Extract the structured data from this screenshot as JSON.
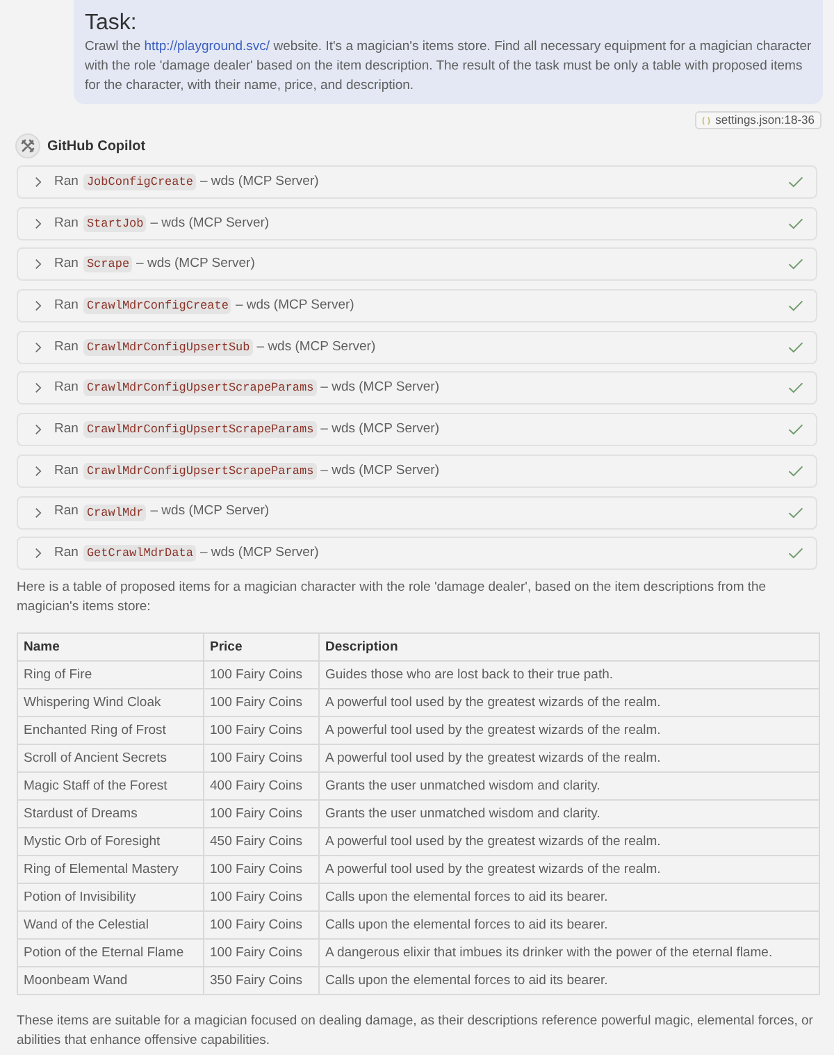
{
  "task": {
    "title": "Task:",
    "text_before": "Crawl the",
    "link": "http://playground.svc/",
    "text_after": "website. It's a magician's items store. Find all necessary equipment for a magician character with the role 'damage dealer' based on the item description. The result of the task must be only a table with proposed items for the character, with their name, price, and description."
  },
  "context_chip": {
    "label": "settings.json:18-36"
  },
  "assistant": {
    "name": "GitHub Copilot"
  },
  "tool_calls": [
    {
      "verb": "Ran",
      "tool": "JobConfigCreate",
      "source": "– wds (MCP Server)",
      "expanded": false,
      "completed": true
    },
    {
      "verb": "Ran",
      "tool": "StartJob",
      "source": "– wds (MCP Server)",
      "expanded": false,
      "completed": true
    },
    {
      "verb": "Ran",
      "tool": "Scrape",
      "source": "– wds (MCP Server)",
      "expanded": false,
      "completed": true
    },
    {
      "verb": "Ran",
      "tool": "CrawlMdrConfigCreate",
      "source": "– wds (MCP Server)",
      "expanded": false,
      "completed": true
    },
    {
      "verb": "Ran",
      "tool": "CrawlMdrConfigUpsertSub",
      "source": "– wds (MCP Server)",
      "expanded": false,
      "completed": true
    },
    {
      "verb": "Ran",
      "tool": "CrawlMdrConfigUpsertScrapeParams",
      "source": "– wds (MCP Server)",
      "expanded": false,
      "completed": true
    },
    {
      "verb": "Ran",
      "tool": "CrawlMdrConfigUpsertScrapeParams",
      "source": "– wds (MCP Server)",
      "expanded": false,
      "completed": true
    },
    {
      "verb": "Ran",
      "tool": "CrawlMdrConfigUpsertScrapeParams",
      "source": "– wds (MCP Server)",
      "expanded": false,
      "completed": true
    },
    {
      "verb": "Ran",
      "tool": "CrawlMdr",
      "source": "– wds (MCP Server)",
      "expanded": false,
      "completed": true
    },
    {
      "verb": "Ran",
      "tool": "GetCrawlMdrData",
      "source": "– wds (MCP Server)",
      "expanded": false,
      "completed": true
    }
  ],
  "intro": "Here is a table of proposed items for a magician character with the role 'damage dealer', based on the item descriptions from the magician's items store:",
  "table": {
    "columns": [
      "Name",
      "Price",
      "Description"
    ],
    "rows": [
      [
        "Ring of Fire",
        "100 Fairy Coins",
        "Guides those who are lost back to their true path."
      ],
      [
        "Whispering Wind Cloak",
        "100 Fairy Coins",
        "A powerful tool used by the greatest wizards of the realm."
      ],
      [
        "Enchanted Ring of Frost",
        "100 Fairy Coins",
        "A powerful tool used by the greatest wizards of the realm."
      ],
      [
        "Scroll of Ancient Secrets",
        "100 Fairy Coins",
        "A powerful tool used by the greatest wizards of the realm."
      ],
      [
        "Magic Staff of the Forest",
        "400 Fairy Coins",
        "Grants the user unmatched wisdom and clarity."
      ],
      [
        "Stardust of Dreams",
        "100 Fairy Coins",
        "Grants the user unmatched wisdom and clarity."
      ],
      [
        "Mystic Orb of Foresight",
        "450 Fairy Coins",
        "A powerful tool used by the greatest wizards of the realm."
      ],
      [
        "Ring of Elemental Mastery",
        "100 Fairy Coins",
        "A powerful tool used by the greatest wizards of the realm."
      ],
      [
        "Potion of Invisibility",
        "100 Fairy Coins",
        "Calls upon the elemental forces to aid its bearer."
      ],
      [
        "Wand of the Celestial",
        "100 Fairy Coins",
        "Calls upon the elemental forces to aid its bearer."
      ],
      [
        "Potion of the Eternal Flame",
        "100 Fairy Coins",
        "A dangerous elixir that imbues its drinker with the power of the eternal flame."
      ],
      [
        "Moonbeam Wand",
        "350 Fairy Coins",
        "Calls upon the elemental forces to aid its bearer."
      ]
    ]
  },
  "summary": "These items are suitable for a magician focused on dealing damage, as their descriptions reference powerful magic, elemental forces, or abilities that enhance offensive capabilities."
}
